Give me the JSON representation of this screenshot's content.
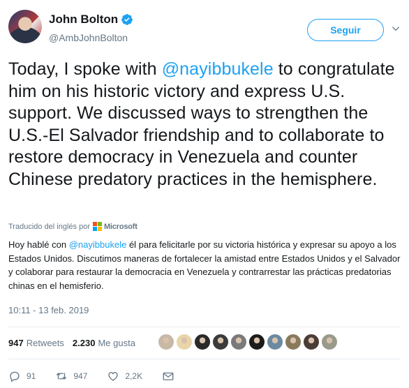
{
  "author": {
    "display_name": "John Bolton",
    "handle": "@AmbJohnBolton",
    "verified": true
  },
  "follow_button": {
    "label": "Seguir"
  },
  "tweet": {
    "text_before": "Today, I spoke with ",
    "mention": "@nayibbukele",
    "text_after": " to congratulate him on his historic victory and express U.S. support. We discussed ways to strengthen the U.S.-El Salvador friendship and to collaborate to restore democracy in Venezuela and counter Chinese predatory practices in the hemisphere."
  },
  "translation": {
    "label": "Traducido del inglés por",
    "provider": "Microsoft",
    "text_before": "Hoy hablé con ",
    "mention": "@nayibbukele",
    "text_after": " él para felicitarle por su victoria histórica y expresar su apoyo a los Estados Unidos. Discutimos maneras de fortalecer la amistad entre Estados Unidos y el Salvador y colaborar para restaurar la democracia en Venezuela y contrarrestar las prácticas predatorias chinas en el hemisferio."
  },
  "timestamp": "10:11 - 13 feb. 2019",
  "stats": {
    "retweets_count": "947",
    "retweets_label": "Retweets",
    "likes_count": "2.230",
    "likes_label": "Me gusta"
  },
  "likers": [
    {
      "color": "#c9b8a6",
      "name": "liker-avatar"
    },
    {
      "color": "#e8d5a9",
      "name": "liker-avatar"
    },
    {
      "color": "#2a2a2a",
      "name": "liker-avatar"
    },
    {
      "color": "#3b3b3b",
      "name": "liker-avatar"
    },
    {
      "color": "#7a7a7a",
      "name": "liker-avatar"
    },
    {
      "color": "#1c1c1c",
      "name": "liker-avatar"
    },
    {
      "color": "#6b8aa0",
      "name": "liker-avatar"
    },
    {
      "color": "#8a7a5c",
      "name": "liker-avatar"
    },
    {
      "color": "#4a3d35",
      "name": "liker-avatar"
    },
    {
      "color": "#9a9a8a",
      "name": "liker-avatar"
    }
  ],
  "actions": {
    "replies": "91",
    "retweets": "947",
    "likes": "2,2K"
  },
  "colors": {
    "accent": "#1da1f2",
    "muted": "#657786",
    "text": "#14171a",
    "divider": "#e6ecf0"
  },
  "icons": [
    "verified-badge-icon",
    "chevron-down-icon",
    "microsoft-logo-icon",
    "reply-icon",
    "retweet-icon",
    "like-icon",
    "direct-message-icon"
  ]
}
